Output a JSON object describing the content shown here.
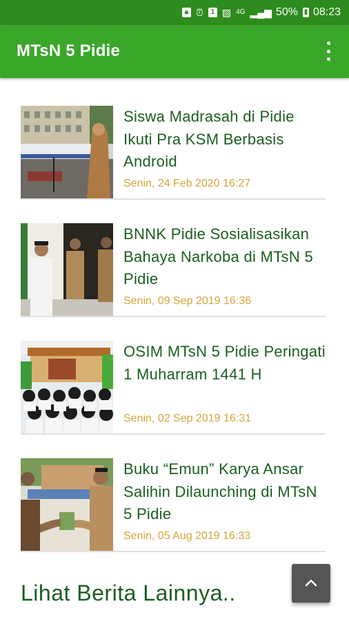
{
  "status_bar": {
    "battery": "50%",
    "time": "08:23",
    "icons": [
      "lock-icon",
      "alarm-icon",
      "sim-icon",
      "image-icon",
      "lte-icon",
      "signal-icon",
      "battery-icon"
    ]
  },
  "app_bar": {
    "title": "MTsN 5 Pidie",
    "menu_icon": "more-vert-icon",
    "color": "#3aa62a"
  },
  "news": [
    {
      "title": "Siswa Madrasah di Pidie Ikuti Pra KSM Berbasis Android",
      "date": "Senin, 24 Feb 2020 16:27"
    },
    {
      "title": "BNNK Pidie Sosialisasikan Bahaya Narkoba di MTsN 5 Pidie",
      "date": "Senin, 09 Sep 2019 16:36"
    },
    {
      "title": "OSIM MTsN 5 Pidie Peringati 1 Muharram 1441 H",
      "date": "Senin, 02 Sep 2019 16:31"
    },
    {
      "title": "Buku “Emun” Karya Ansar Salihin Dilaunching di MTsN 5 Pidie",
      "date": "Senin, 05 Aug 2019 16:33"
    }
  ],
  "more_link": "Lihat Berita Lainnya..",
  "fab_icon": "chevron-up-icon",
  "colors": {
    "headline": "#1b5e20",
    "date": "#d4a63a",
    "statusbar": "#2e8b1d"
  }
}
